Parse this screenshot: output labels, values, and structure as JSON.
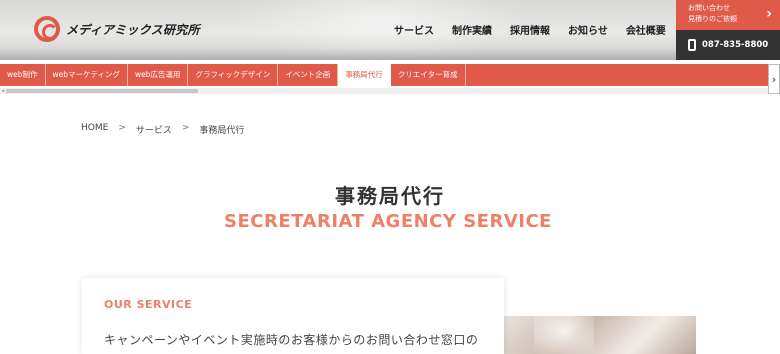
{
  "header": {
    "logo_text": "メディアミックス研究所",
    "nav": [
      "サービス",
      "制作実績",
      "採用情報",
      "お知らせ",
      "会社概要"
    ],
    "contact": {
      "line1": "お問い合わせ",
      "line2": "見積りのご依頼",
      "arrow": "›",
      "phone": "087-835-8800"
    }
  },
  "subnav": {
    "items": [
      "web制作",
      "webマーケティング",
      "web広告運用",
      "グラフィックデザイン",
      "イベント企画",
      "事務局代行",
      "クリエイター育成"
    ],
    "next": "›",
    "scroll_left": "◂"
  },
  "breadcrumb": {
    "home": "HOME",
    "sep": ">",
    "level1": "サービス",
    "current": "事務局代行"
  },
  "page": {
    "title": "事務局代行",
    "subtitle": "SECRETARIAT AGENCY SERVICE"
  },
  "service": {
    "heading": "OUR SERVICE",
    "text": "キャンペーンやイベント実施時のお客様からのお問い合わせ窓口の"
  },
  "colors": {
    "accent": "#e05a4a",
    "subtitle": "#ef8068",
    "dark": "#333333"
  }
}
